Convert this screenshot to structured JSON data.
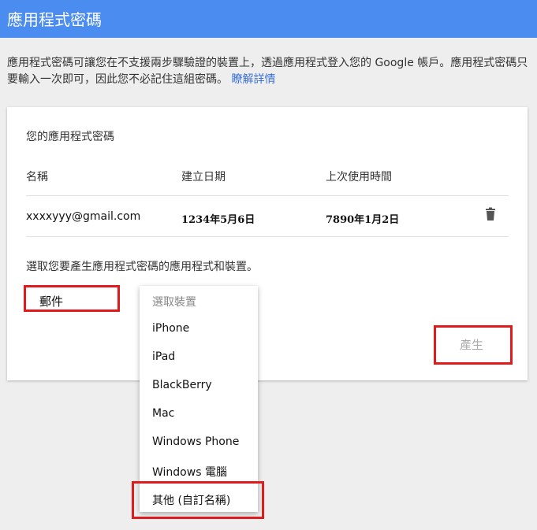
{
  "header": {
    "title": "應用程式密碼"
  },
  "description": {
    "text": "應用程式密碼可讓您在不支援兩步驟驗證的裝置上，透過應用程式登入您的 Google 帳戶。應用程式密碼只要輸入一次即可，因此您不必記住這組密碼。",
    "link": "瞭解詳情"
  },
  "passwords": {
    "title": "您的應用程式密碼",
    "columns": [
      "名稱",
      "建立日期",
      "上次使用時間"
    ],
    "rows": [
      {
        "name": "xxxxyyy@gmail.com",
        "created": "1234年5月6日",
        "last_used": "7890年1月2日",
        "delete_icon": "trash-icon"
      }
    ]
  },
  "generator": {
    "prompt": "選取您要產生應用程式密碼的應用程式和裝置。",
    "app_select_value": "郵件",
    "generate_label": "產生",
    "device_options": [
      "選取裝置",
      "iPhone",
      "iPad",
      "BlackBerry",
      "Mac",
      "Windows Phone",
      "Windows 電腦",
      "其他 (自訂名稱)"
    ]
  },
  "colors": {
    "header_bg": "#4a8cf0",
    "link": "#3a6fd8",
    "highlight": "#e01b1b"
  }
}
